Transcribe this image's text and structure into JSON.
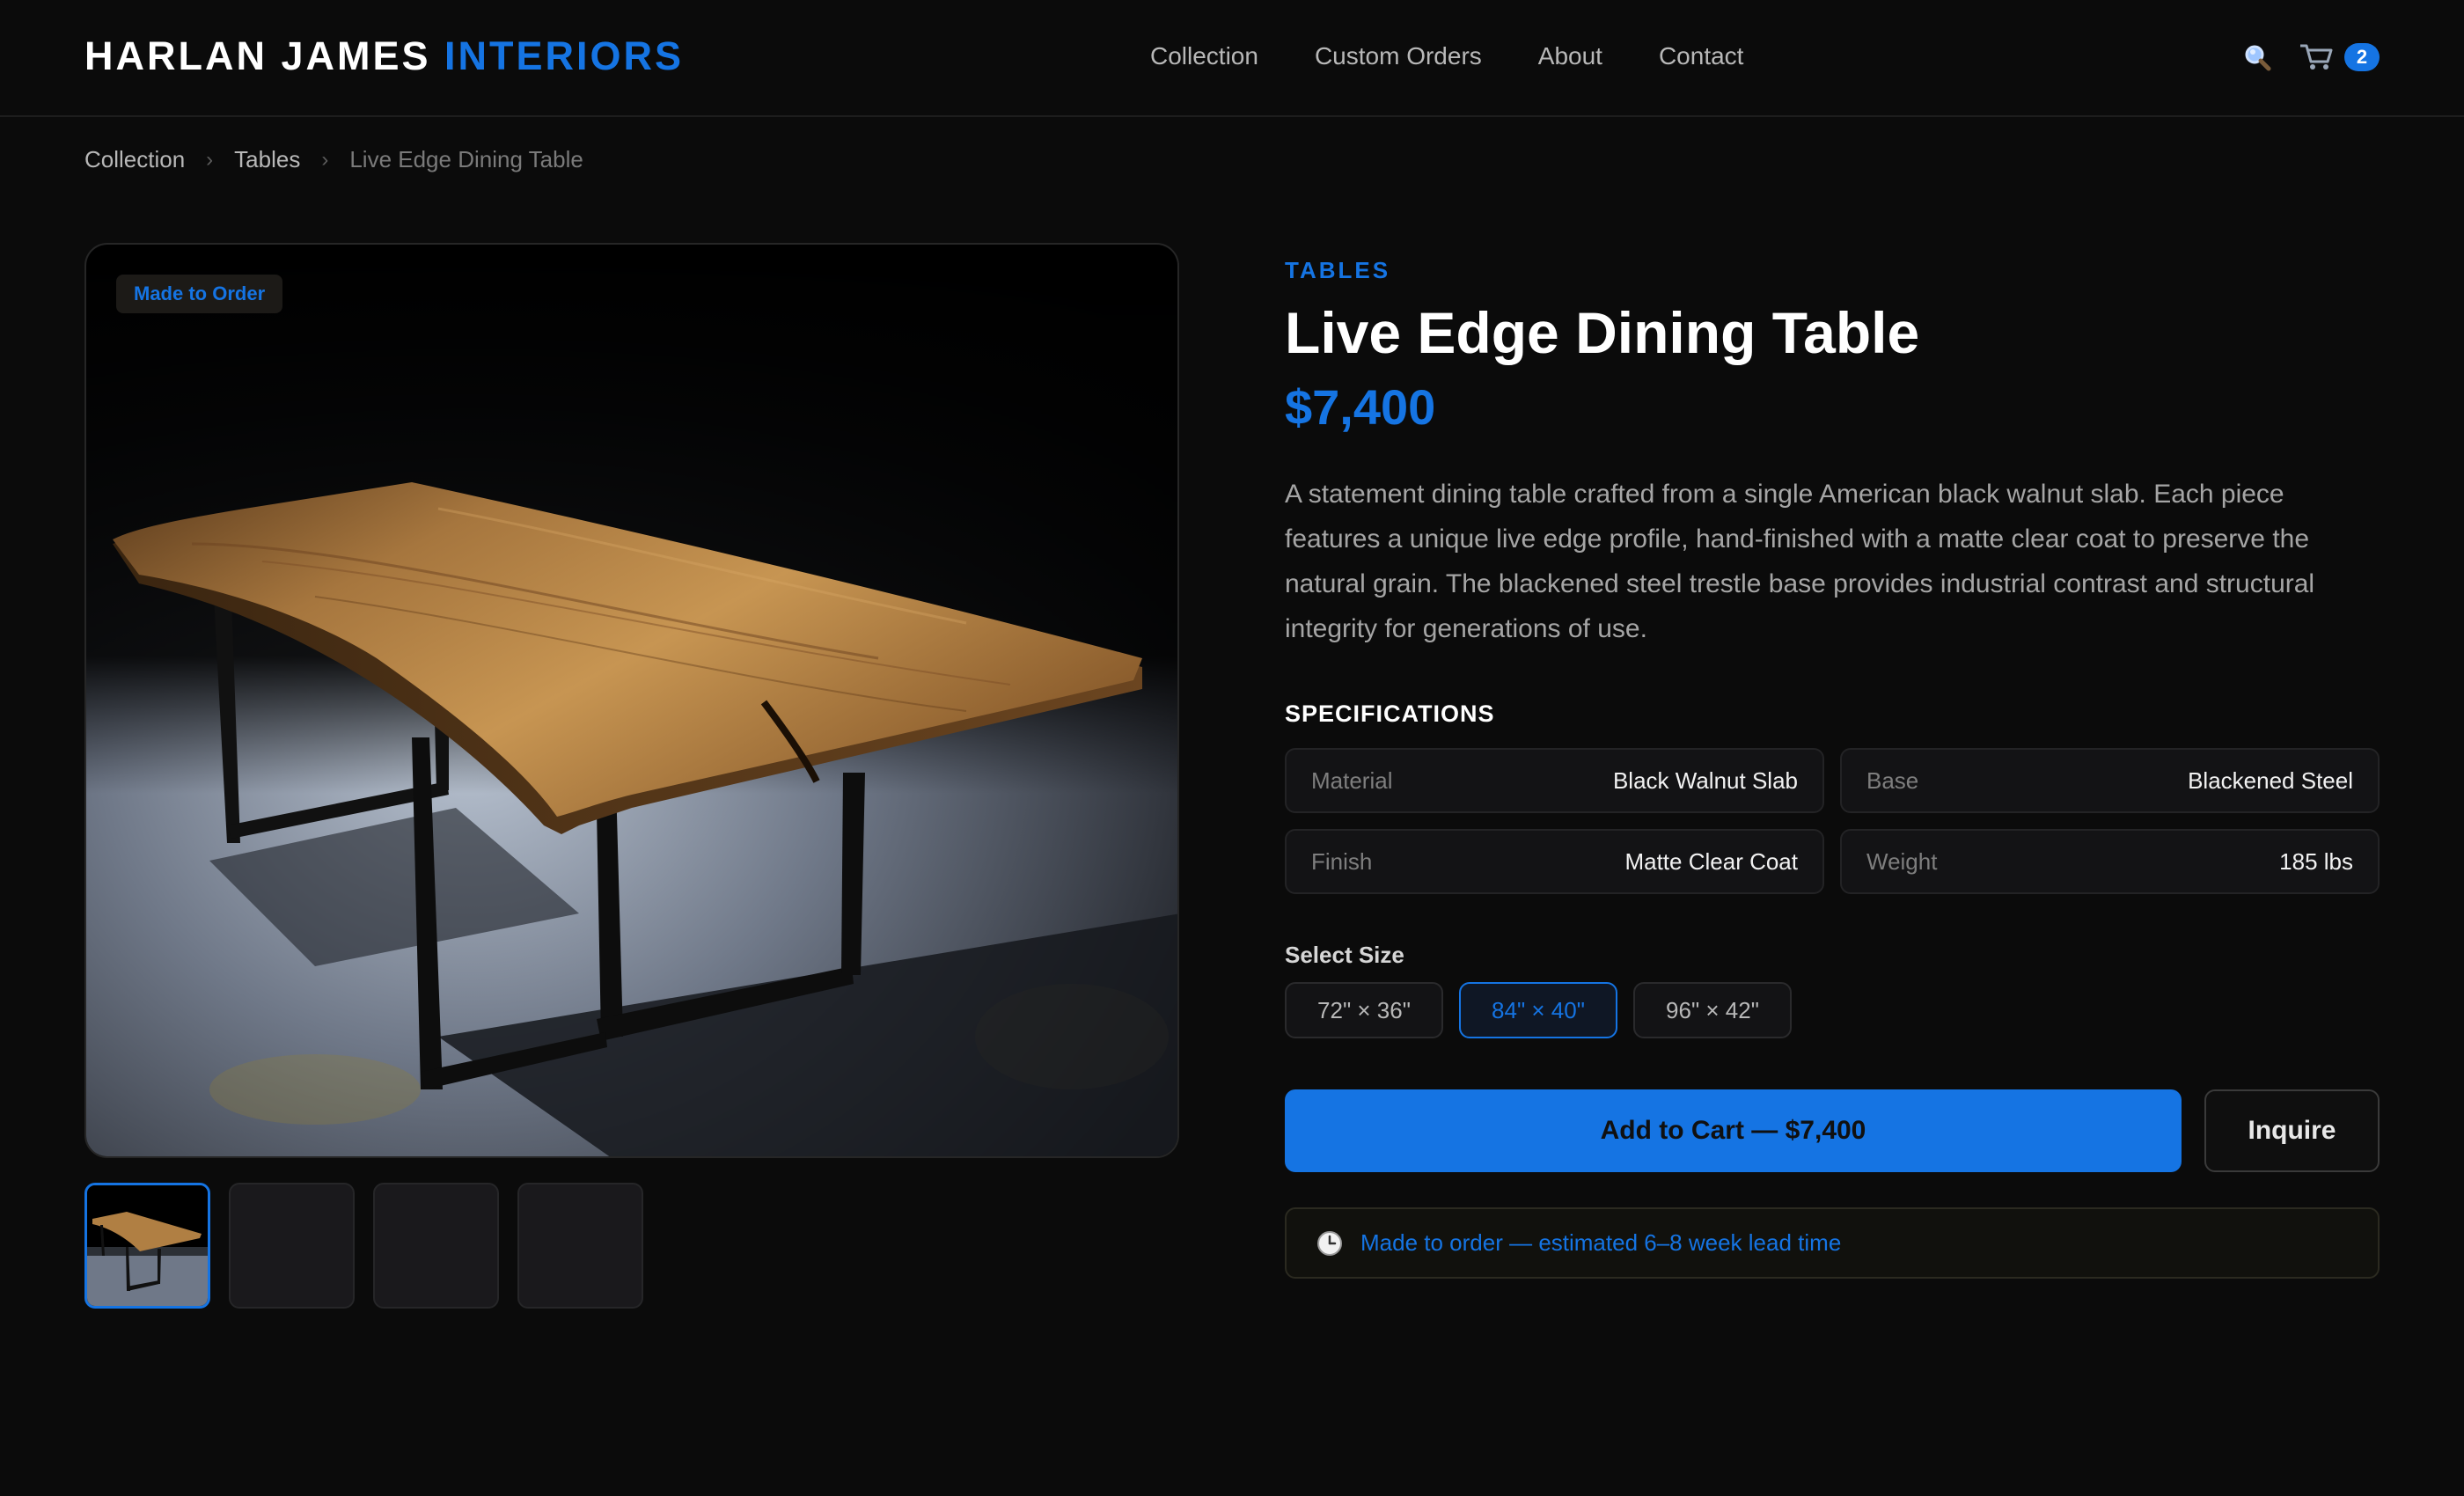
{
  "brand": {
    "name_part1": "HARLAN JAMES",
    "name_part2": "INTERIORS"
  },
  "nav": {
    "items": [
      "Collection",
      "Custom Orders",
      "About",
      "Contact"
    ]
  },
  "header": {
    "search_icon": "search-icon",
    "cart_icon": "cart-icon",
    "cart_count": "2"
  },
  "breadcrumb": [
    "Collection",
    "Tables",
    "Live Edge Dining Table"
  ],
  "gallery": {
    "badge": "Made to Order",
    "thumbnail_count": 4,
    "active_thumbnail": 1
  },
  "product": {
    "category": "TABLES",
    "title": "Live Edge Dining Table",
    "price": "$7,400",
    "description": "A statement dining table crafted from a single American black walnut slab. Each piece features a unique live edge profile, hand-finished with a matte clear coat to preserve the natural grain. The blackened steel trestle base provides industrial contrast and structural integrity for generations of use."
  },
  "specs": {
    "heading": "SPECIFICATIONS",
    "items": [
      {
        "label": "Material",
        "value": "Black Walnut Slab"
      },
      {
        "label": "Base",
        "value": "Blackened Steel"
      },
      {
        "label": "Finish",
        "value": "Matte Clear Coat"
      },
      {
        "label": "Weight",
        "value": "185 lbs"
      }
    ]
  },
  "size": {
    "heading": "Select Size",
    "options": [
      "72\" × 36\"",
      "84\" × 40\"",
      "96\" × 42\""
    ],
    "selected": "84\" × 40\""
  },
  "actions": {
    "add_to_cart": "Add to Cart — $7,400",
    "inquire": "Inquire"
  },
  "lead_time": {
    "icon": "clock-icon",
    "text": "Made to order — estimated 6–8 week lead time"
  },
  "colors": {
    "accent": "#1574e3",
    "background": "#0b0b0b",
    "text_muted": "#a5a5a5"
  }
}
